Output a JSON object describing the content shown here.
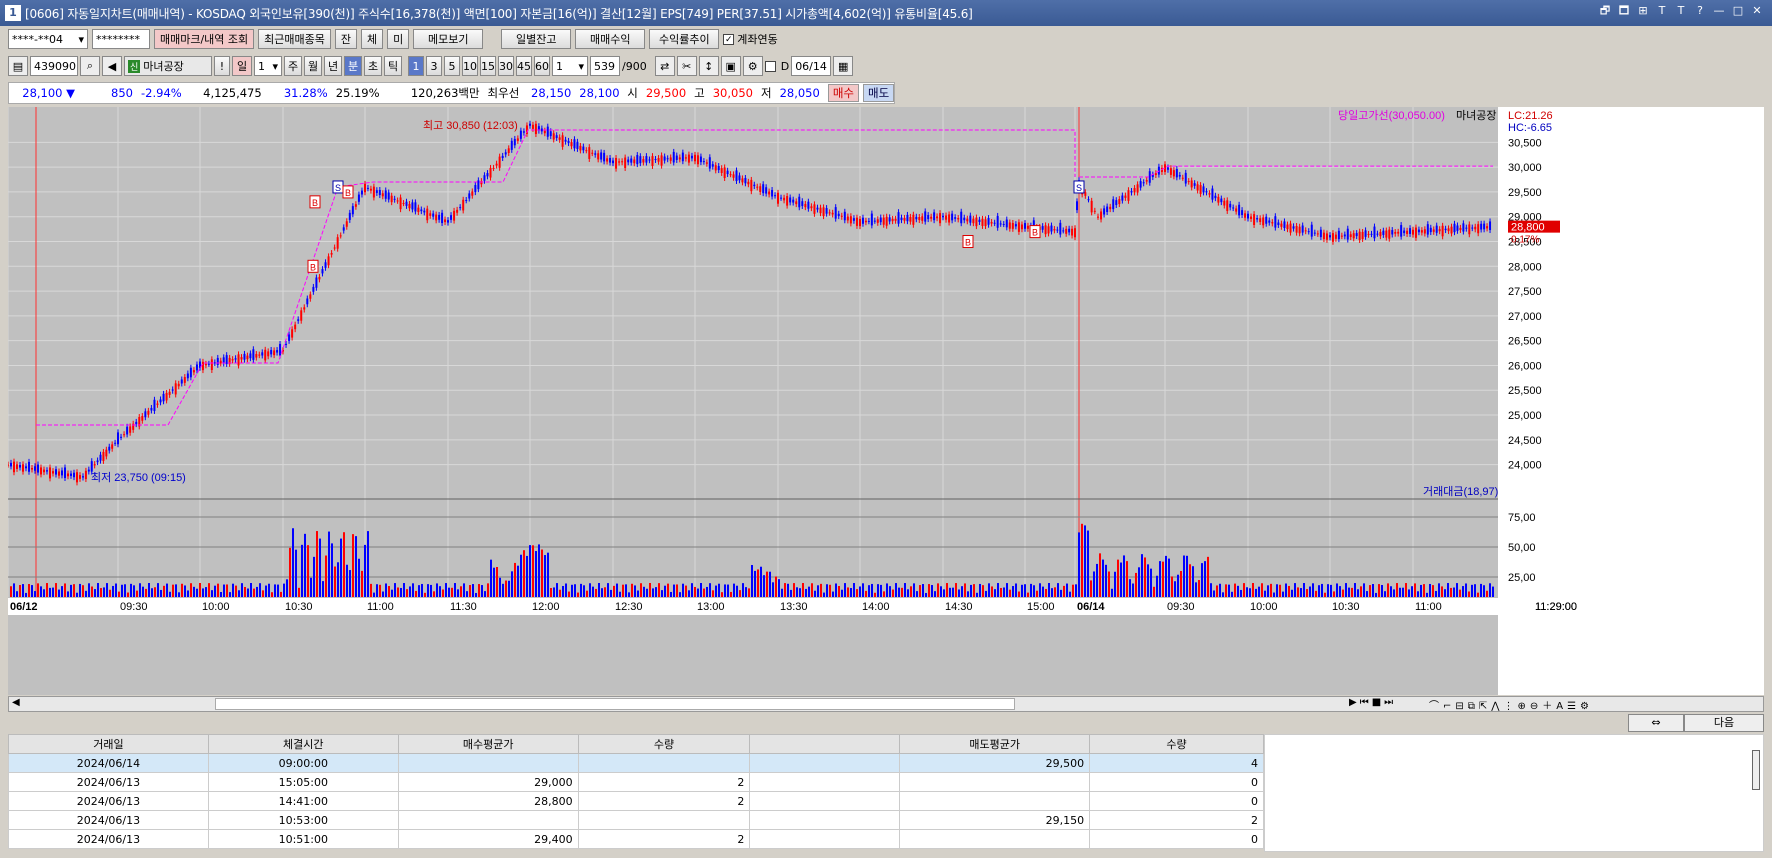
{
  "titlebar": {
    "app_number": "1",
    "title": "[0606] 자동일지차트(매매내역) - KOSDAQ 외국인보유[390(천)] 주식수[16,378(천)] 액면[100] 자본금[16(억)] 결산[12월] EPS[749] PER[37.51] 시가총액[4,602(억)] 유통비율[45.6]",
    "controls": [
      "🗗",
      "🗖",
      "⊞",
      "T",
      "T",
      "?",
      "—",
      "□",
      "✕"
    ]
  },
  "toolbar1": {
    "account": "****-**04",
    "password": "********",
    "btn_trade_mark": "매매마크/내역 조회",
    "btn_recent": "최근매매종목",
    "btn_jan": "잔",
    "btn_che": "체",
    "btn_mi": "미",
    "btn_memo": "메모보기",
    "btn_daily": "일별잔고",
    "btn_profit": "매매수익",
    "btn_rate": "수익률추이",
    "acct_link_label": "계좌연동",
    "acct_link_checked": true
  },
  "toolbar2": {
    "code": "439090",
    "stock_name": "마녀공장",
    "flag": "신",
    "excl": "!",
    "period_day": "일",
    "period_num": "1",
    "periods": [
      "주",
      "월",
      "년",
      "분",
      "초",
      "틱"
    ],
    "selected_period": "분",
    "minutes": [
      "1",
      "3",
      "5",
      "10",
      "15",
      "30",
      "45",
      "60"
    ],
    "selected_minute": "1",
    "interval": "1",
    "count": "539",
    "count_total": "/900",
    "d_label": "D",
    "date": "06/14"
  },
  "info": {
    "price": "28,100 ▼",
    "change": "850",
    "change_pct": "-2.94%",
    "volume": "4,125,475",
    "rate1": "31.28%",
    "rate2": "25.19%",
    "amount": "120,263백만",
    "best_bid_label": "최우선",
    "best1": "28,150",
    "best2": "28,100",
    "open_label": "시",
    "open": "29,500",
    "high_label": "고",
    "high": "30,050",
    "low_label": "저",
    "low": "28,050",
    "buy": "매수",
    "sell": "매도"
  },
  "chart": {
    "legend_high": "당일고가선(30,050.00)",
    "legend_stock": "마녀공장",
    "lc": "LC:21.26",
    "hc": "HC:-6.65",
    "annot_high": "최고 30,850 (12:03)",
    "annot_low": "최저 23,750 (09:15)",
    "current_price": "28,800",
    "current_pct": "0.17%",
    "price_ticks": [
      "30,500",
      "30,000",
      "29,500",
      "29,000",
      "28,500",
      "28,000",
      "27,500",
      "27,000",
      "26,500",
      "26,000",
      "25,500",
      "25,000",
      "24,500",
      "24,000"
    ],
    "vol_legend": "거래대금(18,97)",
    "vol_ticks": [
      "75,00",
      "50,00",
      "25,00"
    ],
    "time_labels": [
      "06/12",
      "09:30",
      "10:00",
      "10:30",
      "11:00",
      "11:30",
      "12:00",
      "12:30",
      "13:00",
      "13:30",
      "14:00",
      "14:30",
      "15:00",
      "06/14",
      "09:30",
      "10:00",
      "10:30",
      "11:00",
      "11:29:00"
    ],
    "marker_letters": [
      "S",
      "B"
    ],
    "up_color": "#ff0000",
    "down_color": "#0000ff",
    "line_color": "#ff00ff"
  },
  "chart_data": {
    "type": "line",
    "title": "마녀공장 1분",
    "ylim": [
      23750,
      30850
    ],
    "x": [
      "06/12 09:00",
      "09:15",
      "09:30",
      "10:00",
      "10:30",
      "11:00",
      "11:30",
      "12:03",
      "12:30",
      "13:00",
      "13:30",
      "14:00",
      "14:30",
      "15:00",
      "15:20",
      "06/14 09:00",
      "09:15",
      "09:30",
      "10:00",
      "10:30",
      "11:00",
      "11:29"
    ],
    "series": [
      {
        "name": "마녀공장",
        "values": [
          24000,
          23750,
          24500,
          26000,
          26300,
          29600,
          28900,
          30850,
          30100,
          30200,
          29400,
          28900,
          29000,
          28800,
          28700,
          29700,
          29000,
          30000,
          29000,
          28600,
          28700,
          28800
        ]
      }
    ]
  },
  "scroll": {
    "next": "다음"
  },
  "table": {
    "headers": [
      "거래일",
      "체결시간",
      "매수평균가",
      "수량",
      "",
      "매도평균가",
      "수량"
    ],
    "rows": [
      [
        "2024/06/14",
        "09:00:00",
        "",
        "",
        "",
        "29,500",
        "4"
      ],
      [
        "2024/06/13",
        "15:05:00",
        "29,000",
        "2",
        "",
        "",
        "0"
      ],
      [
        "2024/06/13",
        "14:41:00",
        "28,800",
        "2",
        "",
        "",
        "0"
      ],
      [
        "2024/06/13",
        "10:53:00",
        "",
        "",
        "",
        "29,150",
        "2"
      ],
      [
        "2024/06/13",
        "10:51:00",
        "29,400",
        "2",
        "",
        "",
        "0"
      ]
    ]
  }
}
